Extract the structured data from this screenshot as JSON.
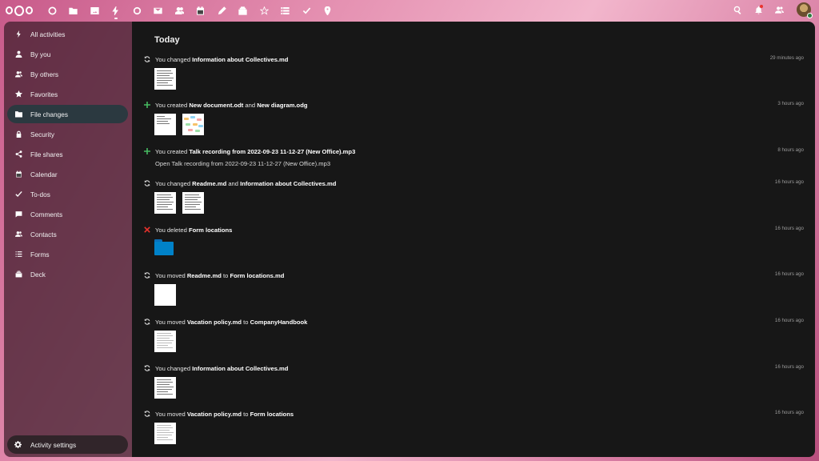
{
  "topbar": {
    "apps": [
      {
        "icon": "dashboard-icon"
      },
      {
        "icon": "files-icon"
      },
      {
        "icon": "photos-icon"
      },
      {
        "icon": "activity-icon",
        "active": true
      },
      {
        "icon": "talk-icon"
      },
      {
        "icon": "mail-icon"
      },
      {
        "icon": "contacts-icon"
      },
      {
        "icon": "calendar-icon"
      },
      {
        "icon": "notes-icon"
      },
      {
        "icon": "deck-icon"
      },
      {
        "icon": "collectives-icon"
      },
      {
        "icon": "forms-icon"
      },
      {
        "icon": "tasks-icon"
      },
      {
        "icon": "maps-icon"
      }
    ],
    "right": [
      "search-icon",
      "notifications-icon",
      "contacts-menu-icon",
      "user-avatar"
    ]
  },
  "sidebar": {
    "items": [
      {
        "label": "All activities",
        "icon": "lightning-icon"
      },
      {
        "label": "By you",
        "icon": "person-icon"
      },
      {
        "label": "By others",
        "icon": "people-icon"
      },
      {
        "label": "Favorites",
        "icon": "star-icon"
      },
      {
        "label": "File changes",
        "icon": "folder-icon",
        "active": true
      },
      {
        "label": "Security",
        "icon": "lock-icon"
      },
      {
        "label": "File shares",
        "icon": "share-icon"
      },
      {
        "label": "Calendar",
        "icon": "calendar-icon"
      },
      {
        "label": "To-dos",
        "icon": "check-icon"
      },
      {
        "label": "Comments",
        "icon": "comment-icon"
      },
      {
        "label": "Contacts",
        "icon": "contacts-icon"
      },
      {
        "label": "Forms",
        "icon": "list-icon"
      },
      {
        "label": "Deck",
        "icon": "deck-icon"
      }
    ],
    "settings_label": "Activity settings"
  },
  "main": {
    "day_title": "Today",
    "activities": [
      {
        "type": "changed",
        "parts": [
          "You changed ",
          "**Information about Collectives.md"
        ],
        "time": "29 minutes ago",
        "preview": "thumbs",
        "thumbs": [
          "doc"
        ]
      },
      {
        "type": "created",
        "parts": [
          "You created ",
          "**New document.odt",
          " and ",
          "**New diagram.odg"
        ],
        "time": "3 hours ago",
        "preview": "thumbs",
        "thumbs": [
          "doc-sparse",
          "diagram"
        ]
      },
      {
        "type": "created",
        "parts": [
          "You created ",
          "**Talk recording from 2022-09-23 11-12-27 (New Office).mp3"
        ],
        "time": "8 hours ago",
        "preview": "sub",
        "sub": "Open Talk recording from 2022-09-23 11-12-27 (New Office).mp3"
      },
      {
        "type": "changed",
        "parts": [
          "You changed ",
          "**Readme.md",
          " and ",
          "**Information about Collectives.md"
        ],
        "time": "16 hours ago",
        "preview": "thumbs",
        "thumbs": [
          "doc",
          "doc"
        ]
      },
      {
        "type": "deleted",
        "parts": [
          "You deleted ",
          "**Form locations"
        ],
        "time": "16 hours ago",
        "preview": "folder"
      },
      {
        "type": "changed",
        "parts": [
          "You moved ",
          "**Readme.md",
          " to ",
          "**Form locations.md"
        ],
        "time": "16 hours ago",
        "preview": "thumbs",
        "thumbs": [
          "blank"
        ]
      },
      {
        "type": "changed",
        "parts": [
          "You moved ",
          "**Vacation policy.md",
          " to ",
          "**CompanyHandbook"
        ],
        "time": "16 hours ago",
        "preview": "thumbs",
        "thumbs": [
          "doc-light"
        ]
      },
      {
        "type": "changed",
        "parts": [
          "You changed ",
          "**Information about Collectives.md"
        ],
        "time": "16 hours ago",
        "preview": "thumbs",
        "thumbs": [
          "doc"
        ]
      },
      {
        "type": "changed",
        "parts": [
          "You moved ",
          "**Vacation policy.md",
          " to ",
          "**Form locations"
        ],
        "time": "16 hours ago",
        "preview": "thumbs",
        "thumbs": [
          "doc-light"
        ]
      }
    ]
  },
  "colors": {
    "created": "#46ba61",
    "deleted": "#e9322d",
    "changed": "#dddddd",
    "active_nav": "#2b3940",
    "folder": "#0082c9"
  }
}
